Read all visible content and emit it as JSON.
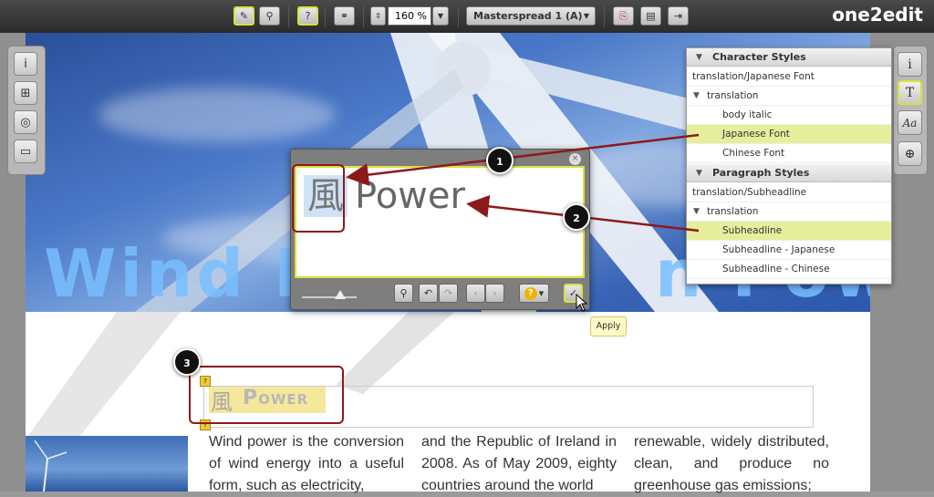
{
  "app": {
    "logo": "one2edit"
  },
  "toolbar": {
    "zoom_value": "160 %",
    "spread_label": "Masterspread 1 (A)",
    "icons": [
      "pencil-icon",
      "magnifier-icon",
      "help-icon",
      "binoculars-icon",
      "stepper-icon",
      "dropdown-icon",
      "pdf-icon",
      "save-icon",
      "exit-icon"
    ]
  },
  "left_tools": [
    "info-icon",
    "hierarchy-icon",
    "compass-icon",
    "comment-icon"
  ],
  "right_tools": [
    "info-icon",
    "text-tool-icon",
    "character-style-icon",
    "globe-icon"
  ],
  "styles_panel": {
    "character": {
      "header": "Character Styles",
      "path": "translation/Japanese Font",
      "group": "translation",
      "items": [
        "body italic",
        "Japanese Font",
        "Chinese Font"
      ],
      "selected": "Japanese Font"
    },
    "paragraph": {
      "header": "Paragraph Styles",
      "path": "translation/Subheadline",
      "group": "translation",
      "items": [
        "Subheadline",
        "Subheadline - Japanese",
        "Subheadline - Chinese"
      ],
      "selected": "Subheadline"
    }
  },
  "editor": {
    "kanji": "風",
    "word": "Power",
    "close_glyph": "×",
    "apply_tooltip": "Apply",
    "help_glyph": "?"
  },
  "document": {
    "hero_headline_left": "Wind Po",
    "hero_headline_right": "n Power",
    "heading_kanji": "風",
    "heading_word": "Power",
    "columns": [
      "Wind power is the conversion of wind energy into a useful form, such as electricity,",
      "and the Republic of Ireland in 2008. As of May 2009, eighty countries around the world",
      "renewable, widely distributed, clean, and produce no greenhouse gas emissions;"
    ]
  },
  "callouts": [
    "1",
    "2",
    "3"
  ],
  "colors": {
    "accent": "#d8e23a",
    "callout": "#8b1a1a",
    "selection": "#e6ee9c"
  }
}
